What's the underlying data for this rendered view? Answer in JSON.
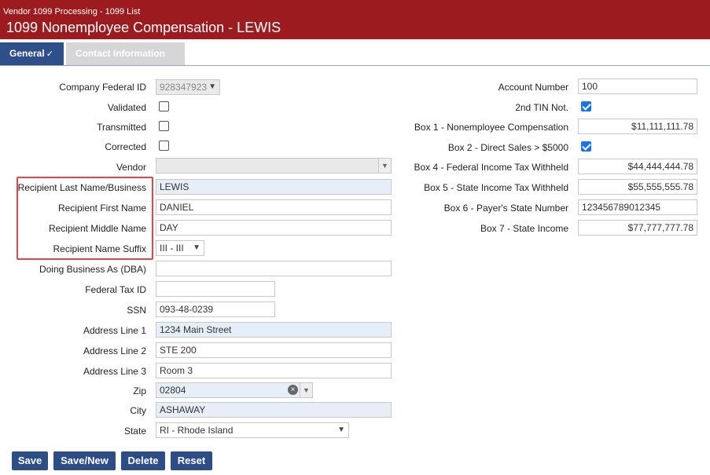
{
  "header": {
    "breadcrumb": "Vendor 1099 Processing - 1099 List",
    "title": "1099 Nonemployee Compensation - LEWIS"
  },
  "tabs": [
    {
      "label": "General",
      "check": "✓"
    },
    {
      "label": "Contact Information"
    }
  ],
  "left": {
    "company_federal_id": {
      "label": "Company Federal ID",
      "value": "928347923"
    },
    "validated": {
      "label": "Validated"
    },
    "transmitted": {
      "label": "Transmitted"
    },
    "corrected": {
      "label": "Corrected"
    },
    "vendor": {
      "label": "Vendor",
      "value": ""
    },
    "last_name": {
      "label": "Recipient Last Name/Business",
      "value": "LEWIS"
    },
    "first_name": {
      "label": "Recipient First Name",
      "value": "DANIEL"
    },
    "middle_name": {
      "label": "Recipient Middle Name",
      "value": "DAY"
    },
    "name_suffix": {
      "label": "Recipient Name Suffix",
      "value": "III - III"
    },
    "dba": {
      "label": "Doing Business As (DBA)",
      "value": ""
    },
    "federal_tax_id": {
      "label": "Federal Tax ID",
      "value": ""
    },
    "ssn": {
      "label": "SSN",
      "value": "093-48-0239"
    },
    "address1": {
      "label": "Address Line 1",
      "value": "1234 Main Street"
    },
    "address2": {
      "label": "Address Line 2",
      "value": "STE 200"
    },
    "address3": {
      "label": "Address Line 3",
      "value": "Room 3"
    },
    "zip": {
      "label": "Zip",
      "value": "02804"
    },
    "city": {
      "label": "City",
      "value": "ASHAWAY"
    },
    "state": {
      "label": "State",
      "value": "RI - Rhode Island"
    }
  },
  "right": {
    "account_number": {
      "label": "Account Number",
      "value": "100"
    },
    "second_tin": {
      "label": "2nd TIN Not."
    },
    "box1": {
      "label": "Box 1 - Nonemployee Compensation",
      "value": "$11,111,111.78"
    },
    "box2": {
      "label": "Box 2 - Direct Sales > $5000"
    },
    "box4": {
      "label": "Box 4 - Federal Income Tax Withheld",
      "value": "$44,444,444.78"
    },
    "box5": {
      "label": "Box 5 - State Income Tax Withheld",
      "value": "$55,555,555.78"
    },
    "box6": {
      "label": "Box 6 - Payer's State Number",
      "value": "123456789012345"
    },
    "box7": {
      "label": "Box 7 - State Income",
      "value": "$77,777,777.78"
    }
  },
  "buttons": {
    "save": "Save",
    "save_new": "Save/New",
    "delete": "Delete",
    "reset": "Reset"
  },
  "icons": {
    "dropdown": "chevron-down-icon",
    "clear": "clear-circle-icon",
    "check": "checkmark-icon"
  }
}
